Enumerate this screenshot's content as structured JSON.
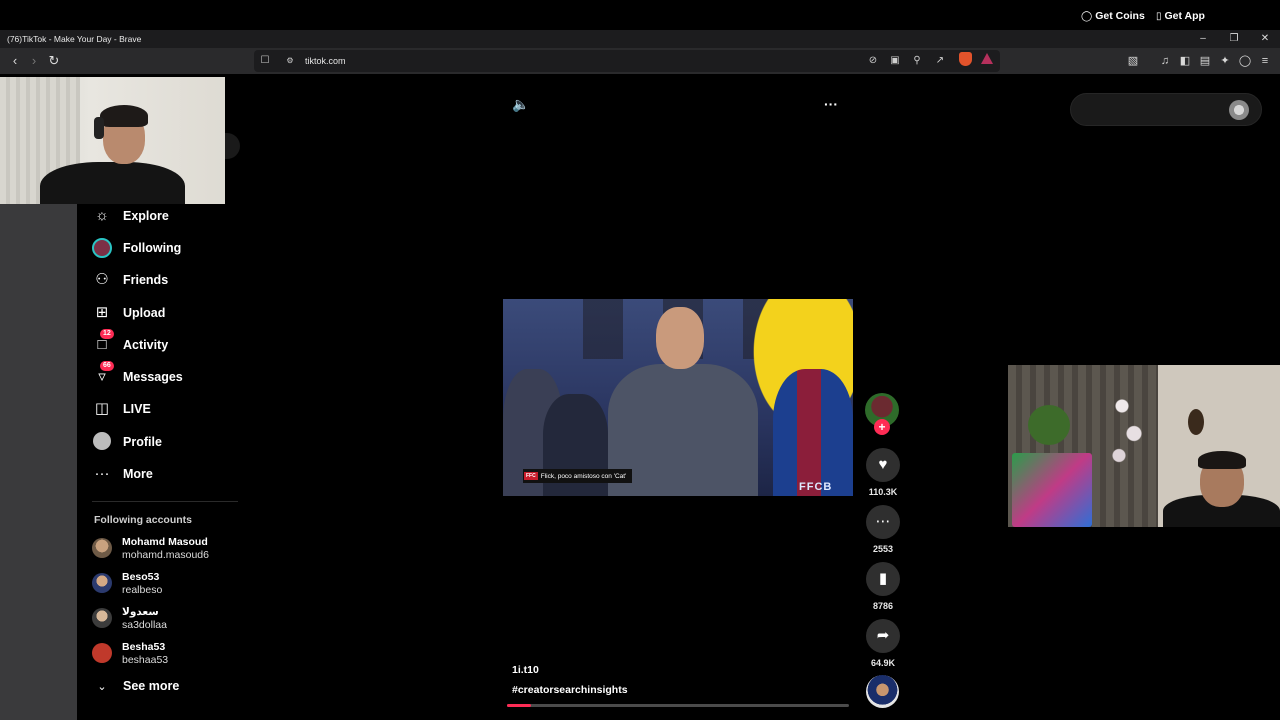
{
  "window": {
    "title": "(76)TikTok - Make Your Day - Brave",
    "controls": [
      "minimize",
      "restore",
      "close"
    ]
  },
  "browser": {
    "url": "tiktok.com",
    "nav_icons": [
      "back-icon",
      "forward-icon",
      "reload-icon",
      "bookmark-icon"
    ],
    "url_icons": [
      "video-off-icon",
      "cast-icon",
      "zoom-icon",
      "share-icon"
    ],
    "toolbar_icons": [
      "tabs-icon",
      "music-icon",
      "sidebar-icon",
      "wallet-icon",
      "leo-icon",
      "vpn-icon",
      "menu-icon"
    ],
    "colors": {
      "shield": "#e2532b",
      "rewards": "#b5305c"
    }
  },
  "sidebar": {
    "items": [
      {
        "label": "Explore",
        "icon": "compass-icon"
      },
      {
        "label": "Following",
        "icon": "following-avatar"
      },
      {
        "label": "Friends",
        "icon": "friends-icon"
      },
      {
        "label": "Upload",
        "icon": "upload-icon"
      },
      {
        "label": "Activity",
        "icon": "activity-icon",
        "badge": "12"
      },
      {
        "label": "Messages",
        "icon": "messages-icon",
        "badge": "66"
      },
      {
        "label": "LIVE",
        "icon": "live-icon"
      },
      {
        "label": "Profile",
        "icon": "profile-avatar"
      },
      {
        "label": "More",
        "icon": "more-icon"
      }
    ],
    "following_title": "Following accounts",
    "accounts": [
      {
        "name": "Mohamd Masoud",
        "handle": "mohamd.masoud6"
      },
      {
        "name": "Beso53",
        "handle": "realbeso"
      },
      {
        "name": "سعدولا",
        "handle": "sa3dollaa"
      },
      {
        "name": "Besha53",
        "handle": "beshaa53"
      }
    ],
    "see_more": "See more"
  },
  "header": {
    "get_coins": "Get Coins",
    "get_app": "Get App"
  },
  "video": {
    "caption_tag": "FFC",
    "caption_text": "Flick, poco amistoso con 'Cat'",
    "watermark": "FFCB",
    "author": "1i.t10",
    "hashtag": "#creatorsearchinsights",
    "progress": 0.07
  },
  "actions": {
    "likes": "110.3K",
    "comments": "2553",
    "saves": "8786",
    "shares": "64.9K"
  },
  "accent": "#fe2c55"
}
